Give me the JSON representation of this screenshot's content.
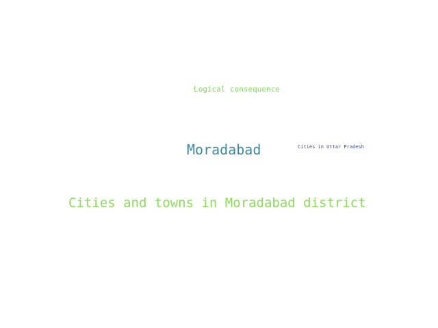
{
  "words": [
    {
      "text": "Logical consequence",
      "color": "#7ed957"
    },
    {
      "text": "Moradabad",
      "color": "#3a8a9a"
    },
    {
      "text": "Cities in Uttar Pradesh",
      "color": "#3f4a8c"
    },
    {
      "text": "Cities and towns in Moradabad district",
      "color": "#8ddc5a"
    }
  ]
}
